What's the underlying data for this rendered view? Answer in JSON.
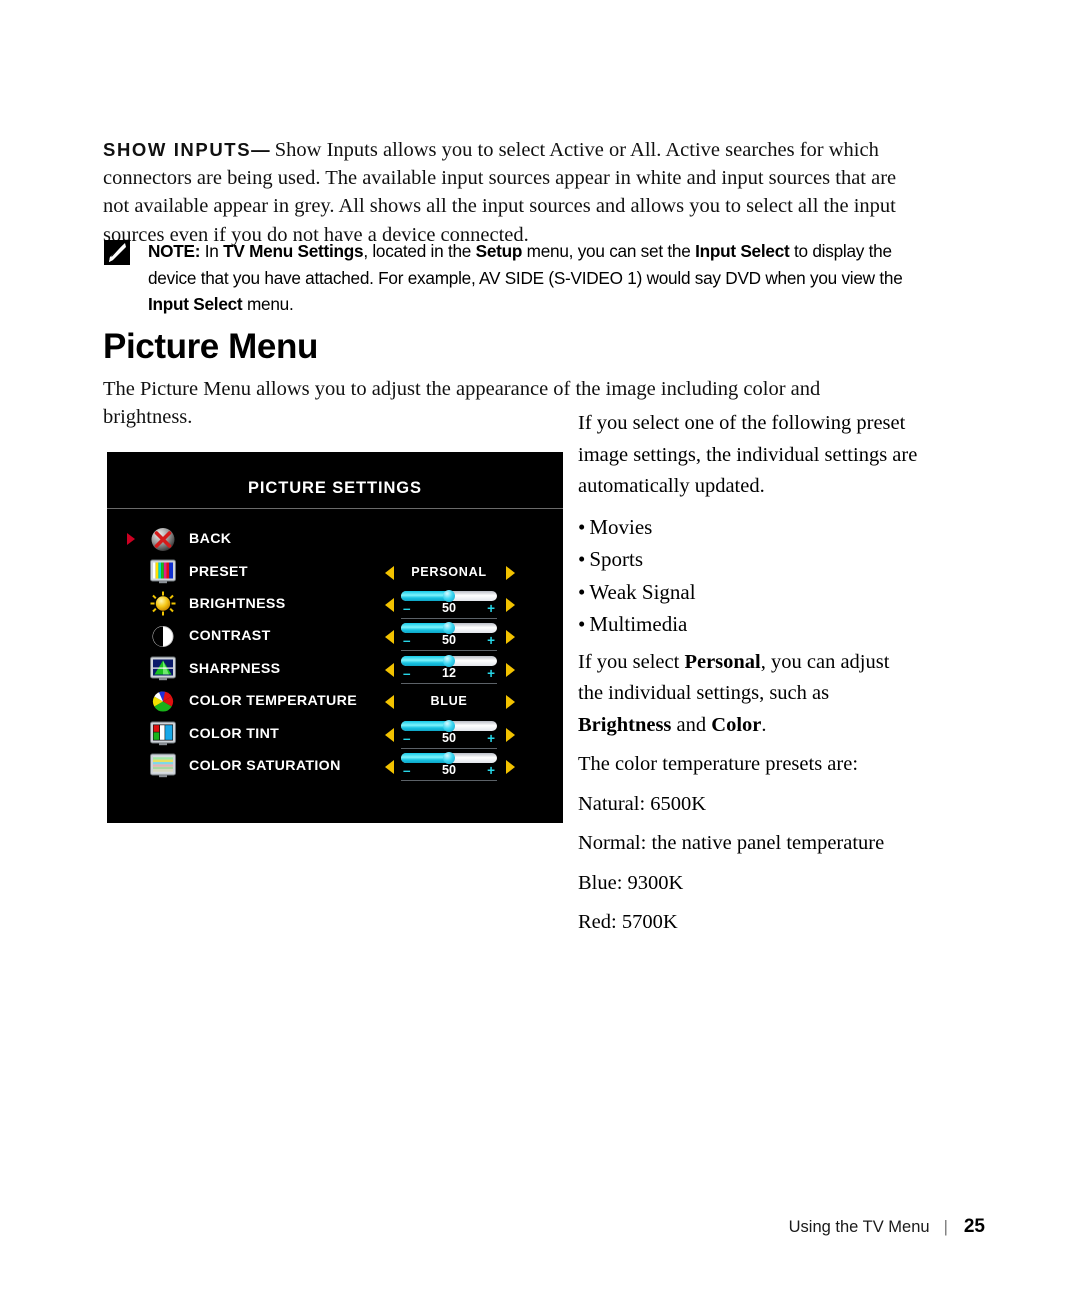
{
  "show_inputs": {
    "term": "SHOW INPUTS",
    "dash": "—",
    "body": "Show Inputs allows you to select Active or All. Active searches for which connectors are being used. The available input sources appear in white and input sources that are not available appear in grey. All shows all the input sources and allows you to select all the input sources even if you do not have a device connected."
  },
  "note": {
    "icon": "pencil-note-icon",
    "label": "NOTE:",
    "part1": " In ",
    "b1": "TV Menu Settings",
    "part2": ", located in the ",
    "b2": "Setup",
    "part3": " menu, you can set the ",
    "b3": "Input Select",
    "part4": " to display the device that you have attached. For example, AV SIDE (S-VIDEO 1) would say DVD when you view the ",
    "b4": "Input Select",
    "part5": " menu."
  },
  "heading": "Picture Menu",
  "intro": "The Picture Menu allows you to adjust the appearance of the image including color and brightness.",
  "right_column": {
    "para1": "If you select one of the following preset image settings, the individual settings are automatically updated.",
    "bullets": [
      "Movies",
      "Sports",
      "Weak Signal",
      "Multimedia"
    ],
    "para2_a": "If you select ",
    "para2_b": "Personal",
    "para2_c": ", you can adjust the individual settings, such as ",
    "para2_d": "Brightness",
    "para2_e": " and ",
    "para2_f": "Color",
    "para2_g": ".",
    "presets_intro": "The color temperature presets are:",
    "preset_lines": [
      "Natural: 6500K",
      "Normal: the native panel temperature",
      "Blue: 9300K",
      "Red: 5700K"
    ]
  },
  "osd": {
    "title": "PICTURE SETTINGS",
    "cursor_row_index": 0,
    "colors": {
      "background": "#000000",
      "title_text": "#ffffff",
      "cursor": "#cc0022",
      "arrow": "#f2c200",
      "slider_fill": "#16c9e8",
      "slider_track": "#ffffff",
      "plus_minus": "#27d7e8"
    },
    "rows": [
      {
        "label": "BACK",
        "icon": "back-cancel-icon",
        "control": "none"
      },
      {
        "label": "PRESET",
        "icon": "preset-colorbars-icon",
        "control": "option",
        "value": "PERSONAL"
      },
      {
        "label": "BRIGHTNESS",
        "icon": "brightness-sun-icon",
        "control": "slider",
        "value": "50",
        "percent": 50,
        "minus": "–",
        "plus": "+"
      },
      {
        "label": "CONTRAST",
        "icon": "contrast-halfcircle-icon",
        "control": "slider",
        "value": "50",
        "percent": 50,
        "minus": "–",
        "plus": "+"
      },
      {
        "label": "SHARPNESS",
        "icon": "sharpness-screen-icon",
        "control": "slider",
        "value": "12",
        "percent": 50,
        "minus": "–",
        "plus": "+"
      },
      {
        "label": "COLOR TEMPERATURE",
        "icon": "color-temperature-wheel-icon",
        "control": "option",
        "value": "BLUE"
      },
      {
        "label": "COLOR TINT",
        "icon": "color-tint-screen-icon",
        "control": "slider",
        "value": "50",
        "percent": 50,
        "minus": "–",
        "plus": "+"
      },
      {
        "label": "COLOR SATURATION",
        "icon": "color-saturation-screen-icon",
        "control": "slider",
        "value": "50",
        "percent": 50,
        "minus": "–",
        "plus": "+"
      }
    ]
  },
  "footer": {
    "text": "Using the TV Menu",
    "separator": "|",
    "page": "25"
  }
}
